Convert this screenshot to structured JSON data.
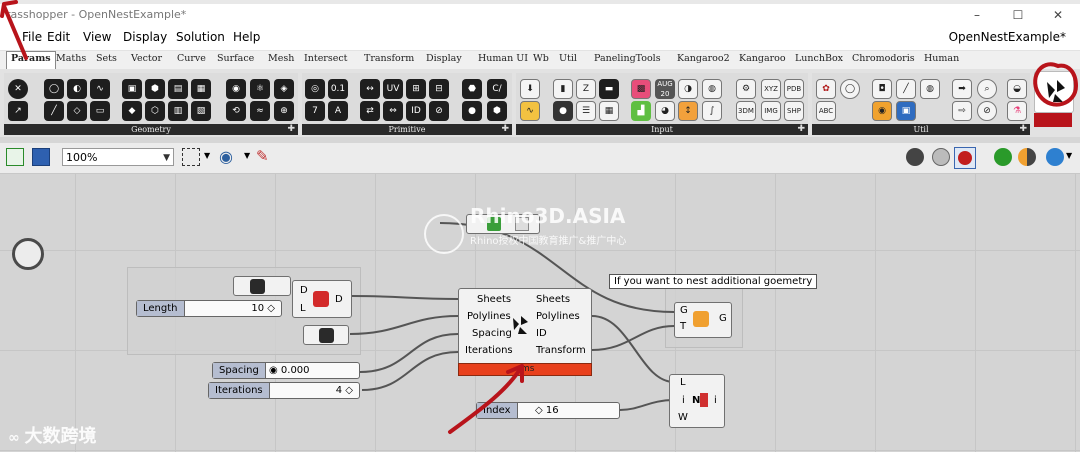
{
  "window": {
    "title": "rasshopper - OpenNestExample*",
    "document_name": "OpenNestExample*",
    "controls": [
      "–",
      "☐",
      "✕"
    ]
  },
  "menu": [
    "File",
    "Edit",
    "View",
    "Display",
    "Solution",
    "Help"
  ],
  "tabs": [
    "Params",
    "Maths",
    "Sets",
    "Vector",
    "Curve",
    "Surface",
    "Mesh",
    "Intersect",
    "Transform",
    "Display",
    "Human UI",
    "Wb",
    "Util",
    "PanelingTools",
    "Kangaroo2",
    "Kangaroo",
    "LunchBox",
    "Chromodoris",
    "Human"
  ],
  "active_tab": "Params",
  "panels": {
    "geometry": "Geometry",
    "primitive": "Primitive",
    "input": "Input",
    "util": "Util"
  },
  "input_badge": {
    "month": "AUG",
    "day": "20"
  },
  "input_labels": [
    "XYZ",
    "PDB",
    "3DM",
    "IMG",
    "SHP"
  ],
  "util_label": "ABC",
  "zoom": "100%",
  "canvas": {
    "tooltip": "If you want to nest additional goemetry",
    "length_slider": {
      "label": "Length",
      "value": "10"
    },
    "spacing_slider": {
      "label": "Spacing",
      "value": "0.000"
    },
    "iterations_slider": {
      "label": "Iterations",
      "value": "4"
    },
    "index_slider": {
      "label": "Index",
      "value": "16"
    },
    "dl_comp": {
      "in": [
        "D",
        "L"
      ],
      "out": "D"
    },
    "nest": {
      "inputs": [
        "Sheets",
        "Polylines",
        "Spacing",
        "Iterations"
      ],
      "outputs": [
        "Sheets",
        "Polylines",
        "ID",
        "Transform"
      ],
      "status": "ems"
    },
    "transform_comp": {
      "in": [
        "G",
        "T"
      ],
      "out": "G"
    },
    "list_comp": {
      "in": [
        "L",
        "i",
        "W"
      ],
      "out": "i",
      "mid": "N"
    }
  },
  "watermark": {
    "site": "Rhino3D.ASIA",
    "subtitle": "Rhino授权中国教育推广&推广中心",
    "corner": "大数跨境"
  },
  "colors": {
    "annotation_red": "#b8141b",
    "nest_status": "#e8401c",
    "slider_label": "#b5bdd0"
  }
}
